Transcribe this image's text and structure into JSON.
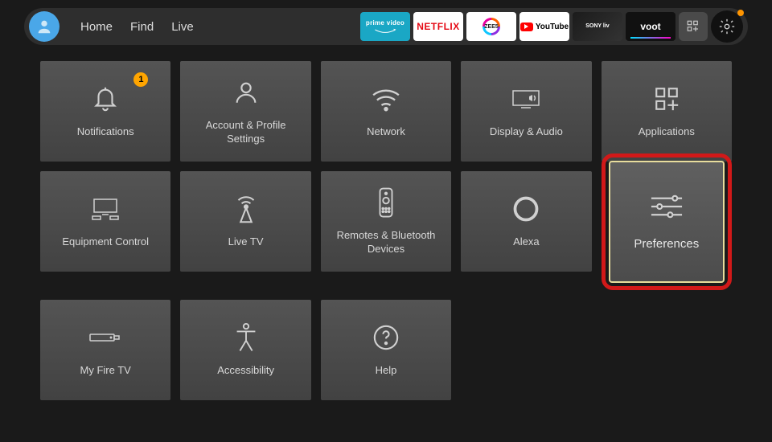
{
  "nav": {
    "home": "Home",
    "find": "Find",
    "live": "Live"
  },
  "apps": {
    "primevideo": "prime video",
    "netflix": "NETFLIX",
    "zee5": "ZEE5",
    "youtube": "YouTube",
    "sonyliv": "SONY liv",
    "voot": "voot"
  },
  "tiles": {
    "notifications": {
      "label": "Notifications",
      "badge": "1"
    },
    "account": {
      "label": "Account & Profile Settings"
    },
    "network": {
      "label": "Network"
    },
    "display": {
      "label": "Display & Audio"
    },
    "applications": {
      "label": "Applications"
    },
    "equipment": {
      "label": "Equipment Control"
    },
    "livetv": {
      "label": "Live TV"
    },
    "remotes": {
      "label": "Remotes & Bluetooth Devices"
    },
    "alexa": {
      "label": "Alexa"
    },
    "preferences": {
      "label": "Preferences"
    },
    "myfiretv": {
      "label": "My Fire TV"
    },
    "accessibility": {
      "label": "Accessibility"
    },
    "help": {
      "label": "Help"
    }
  }
}
